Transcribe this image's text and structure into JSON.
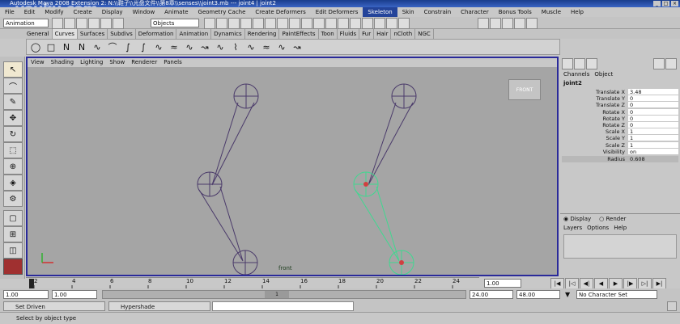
{
  "window": {
    "title": "Autodesk Maya 2008 Extension 2: N:\\\\鞋子\\\\光盘文件\\\\第8章\\\\senses\\\\joint3.mb  ---  joint4 | joint2",
    "watermark": "youku.com",
    "buttons": [
      "_",
      "□",
      "×"
    ]
  },
  "menubar": {
    "items": [
      "File",
      "Edit",
      "Modify",
      "Create",
      "Display",
      "Window",
      "Animate",
      "Geometry Cache",
      "Create Deformers",
      "Edit Deformers",
      "Skeleton",
      "Skin",
      "Constrain",
      "Character",
      "Bonus Tools",
      "Muscle",
      "Help"
    ],
    "active": "Skeleton"
  },
  "statusline": {
    "menuset": "Animation",
    "selection_mode": "Objects"
  },
  "shelf": {
    "tabs": [
      "General",
      "Curves",
      "Surfaces",
      "Subdivs",
      "Deformation",
      "Animation",
      "Dynamics",
      "Rendering",
      "PaintEffects",
      "Toon",
      "Fluids",
      "Fur",
      "Hair",
      "nCloth",
      "NGC"
    ],
    "active_tab": "Curves",
    "icons": [
      "circle-icon",
      "square-icon",
      "cv-curve-icon",
      "ep-curve-icon",
      "pencil-curve-icon",
      "arc-icon",
      "revolve-icon",
      "curve-icon",
      "curve-icon",
      "curve-icon",
      "curve-icon",
      "curve-icon",
      "curve-icon",
      "curve-icon",
      "curve-icon",
      "curve-icon",
      "curve-icon",
      "curve-icon"
    ]
  },
  "viewport": {
    "menus": [
      "View",
      "Shading",
      "Lighting",
      "Show",
      "Renderer",
      "Panels"
    ],
    "cube_label": "FRONT",
    "camera_label": "front"
  },
  "channels": {
    "header_items": [
      "Channels",
      "Object"
    ],
    "object_name": "joint2",
    "attributes": [
      {
        "name": "Translate X",
        "value": "3.48"
      },
      {
        "name": "Translate Y",
        "value": "0"
      },
      {
        "name": "Translate Z",
        "value": "0"
      },
      {
        "name": "Rotate X",
        "value": "0"
      },
      {
        "name": "Rotate Y",
        "value": "0"
      },
      {
        "name": "Rotate Z",
        "value": "0"
      },
      {
        "name": "Scale X",
        "value": "1"
      },
      {
        "name": "Scale Y",
        "value": "1"
      },
      {
        "name": "Scale Z",
        "value": "1"
      },
      {
        "name": "Visibility",
        "value": "on"
      },
      {
        "name": "Radius",
        "value": "0.608"
      }
    ]
  },
  "layers": {
    "radio_display": "Display",
    "radio_render": "Render",
    "menus": [
      "Layers",
      "Options",
      "Help"
    ]
  },
  "timeline": {
    "ticks": [
      "2",
      "4",
      "6",
      "8",
      "10",
      "12",
      "14",
      "16",
      "18",
      "20",
      "22",
      "24"
    ],
    "current_frame": "1.00"
  },
  "range": {
    "start": "1.00",
    "playback_start": "1.00",
    "current": "1",
    "end_field": "24.00",
    "end_field2": "48.00",
    "character_set": "No Character Set"
  },
  "taskbar": {
    "items": [
      "Set Driven",
      "Hypershade"
    ]
  },
  "help_line": "Select by object type"
}
